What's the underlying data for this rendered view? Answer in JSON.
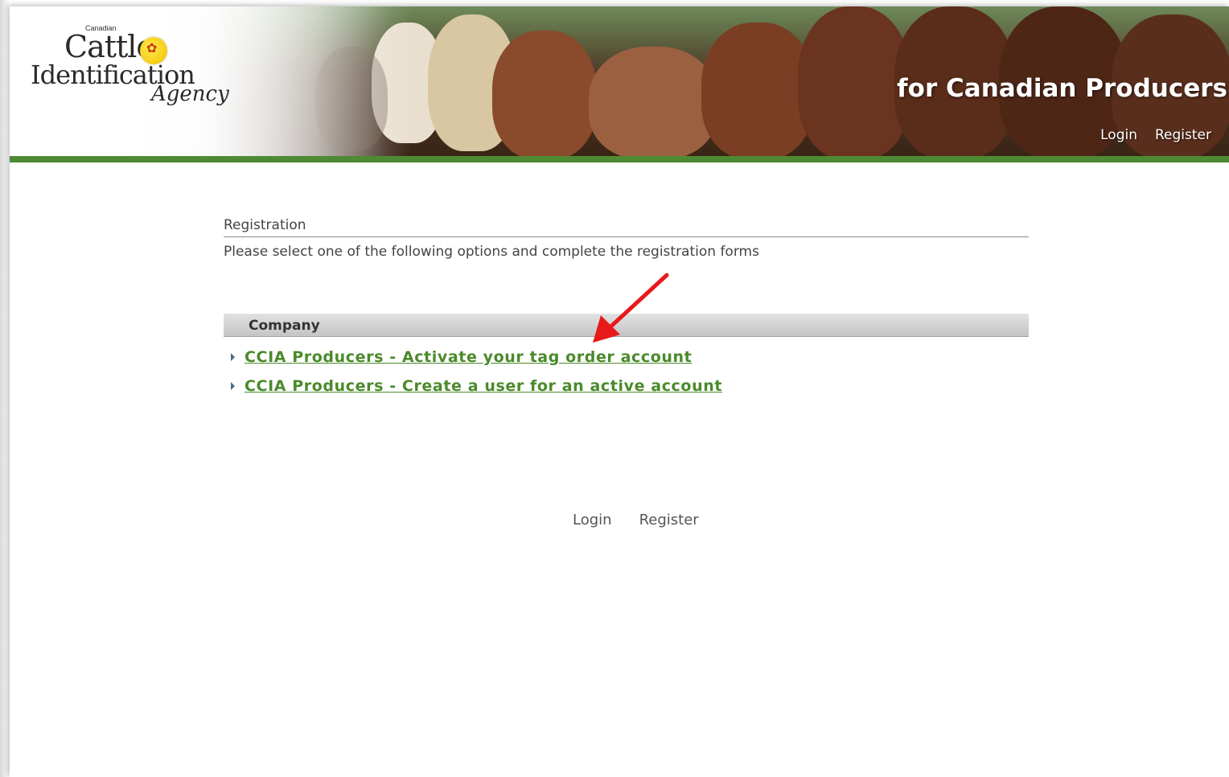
{
  "header": {
    "logo": {
      "small_text": "Canadian",
      "line1": "Cattle",
      "line2": "Identification",
      "line3": "Agency"
    },
    "tagline": "for Canadian Producers",
    "nav": {
      "login": "Login",
      "register": "Register"
    }
  },
  "registration": {
    "title": "Registration",
    "subtitle": "Please select one of the following options and complete the registration forms",
    "section": {
      "title": "Company",
      "links": [
        {
          "label": "CCIA Producers - Activate your tag order account"
        },
        {
          "label": "CCIA Producers - Create a user for an active account"
        }
      ]
    }
  },
  "footer": {
    "login": "Login",
    "register": "Register"
  },
  "colors": {
    "accent_green": "#4e8a34",
    "link_green": "#4a8a2a",
    "annotation_arrow": "#e8191b"
  },
  "icons": {
    "link_bullet": "triangle-right-icon",
    "annotation": "red-arrow"
  }
}
